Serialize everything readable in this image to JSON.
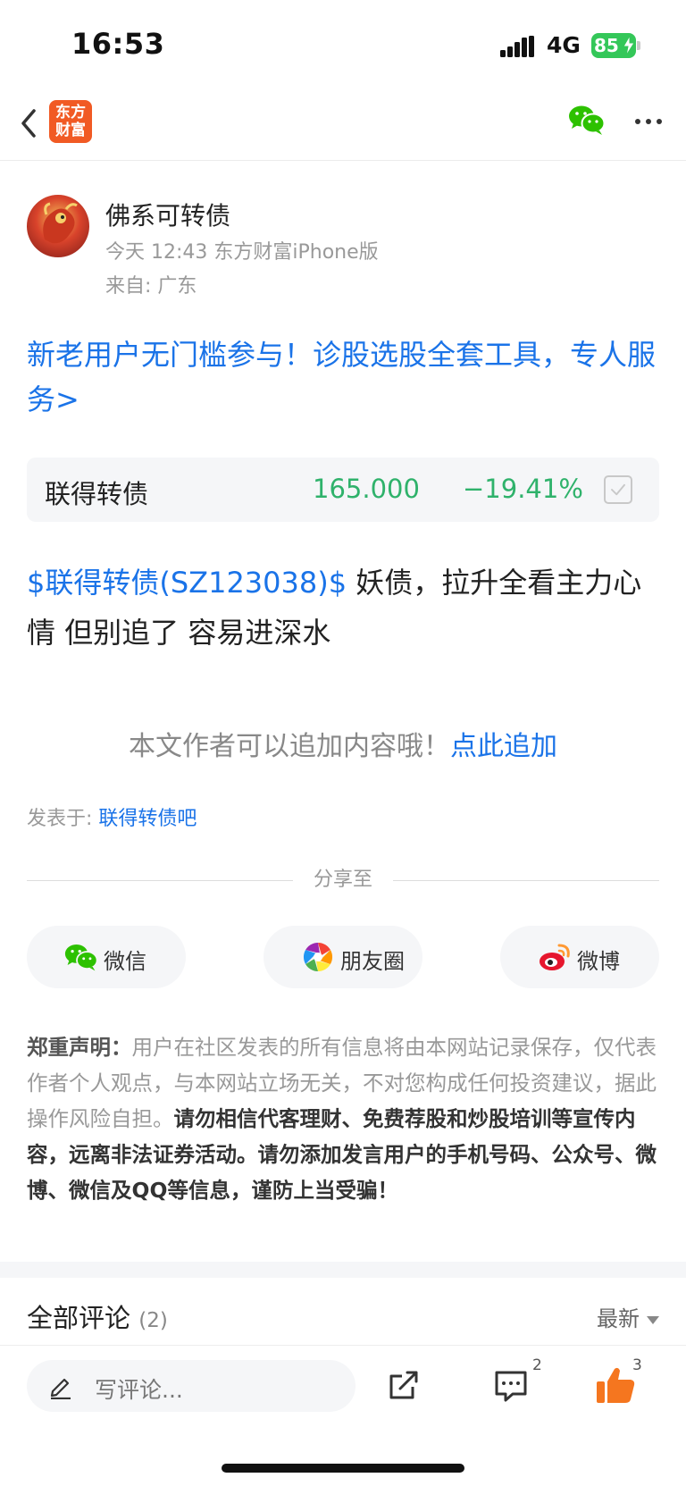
{
  "status_bar": {
    "time": "16:53",
    "network": "4G",
    "battery": "85"
  },
  "nav": {
    "logo_text": "东方财富",
    "icons": [
      "back-icon",
      "wechat-icon",
      "more-icon"
    ]
  },
  "post": {
    "author_name": "佛系可转债",
    "time_source": "今天 12:43 东方财富iPhone版",
    "location": "来自: 广东",
    "promo_text": "新老用户无门槛参与！诊股选股全套工具，专人服务>",
    "quote": {
      "name": "联得转债",
      "price": "165.000",
      "change": "−19.41%"
    },
    "stock_tag": "$联得转债(SZ123038)$",
    "body": "  妖债，拉升全看主力心情 但别追了 容易进深水",
    "append_prompt": "本文作者可以追加内容哦！",
    "append_link": "点此追加",
    "posted_in_label": "发表于: ",
    "posted_in_bar": "联得转债吧"
  },
  "share": {
    "label": "分享至",
    "wechat": "微信",
    "moments": "朋友圈",
    "weibo": "微博"
  },
  "disclaimer": {
    "title": "郑重声明：",
    "normal": "用户在社区发表的所有信息将由本网站记录保存，仅代表作者个人观点，与本网站立场无关，不对您构成任何投资建议，据此操作风险自担。",
    "strong": "请勿相信代客理财、免费荐股和炒股培训等宣传内容，远离非法证券活动。请勿添加发言用户的手机号码、公众号、微博、微信及QQ等信息，谨防上当受骗！"
  },
  "comments": {
    "title": "全部评论",
    "count": "(2)",
    "sort": "最新"
  },
  "bottom_bar": {
    "placeholder": "写评论...",
    "comment_count": "2",
    "like_count": "3"
  },
  "colors": {
    "link_blue": "#1a73e8",
    "quote_green": "#2fb26b",
    "logo_orange": "#f15a24",
    "like_orange": "#f5761f",
    "battery_green": "#34c759"
  }
}
